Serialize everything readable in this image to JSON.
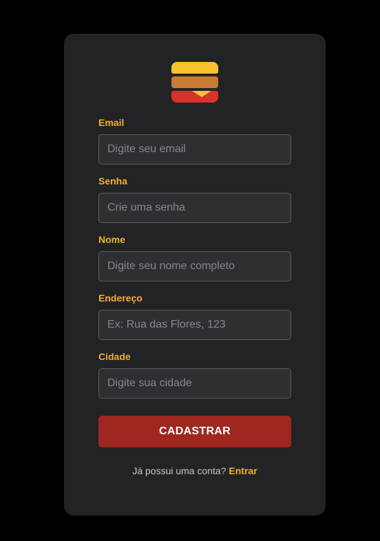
{
  "logo": {
    "icon": "burger-icon"
  },
  "form": {
    "fields": [
      {
        "label": "Email",
        "placeholder": "Digite seu email",
        "value": ""
      },
      {
        "label": "Senha",
        "placeholder": "Crie uma senha",
        "value": ""
      },
      {
        "label": "Nome",
        "placeholder": "Digite seu nome completo",
        "value": ""
      },
      {
        "label": "Endereço",
        "placeholder": "Ex: Rua das Flores, 123",
        "value": ""
      },
      {
        "label": "Cidade",
        "placeholder": "Digite sua cidade",
        "value": ""
      }
    ],
    "submit_label": "CADASTRAR"
  },
  "footer": {
    "prompt": "Já possui uma conta?",
    "link_label": "Entrar"
  },
  "colors": {
    "background": "#000000",
    "card": "#222324",
    "accent": "#f5b02f",
    "button": "#9e271f",
    "input_bg": "#2d3033"
  }
}
